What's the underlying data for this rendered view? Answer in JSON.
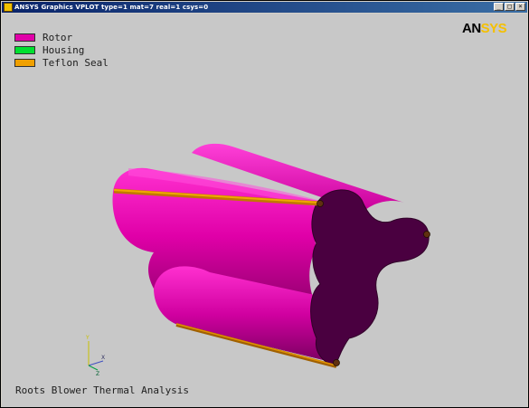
{
  "window": {
    "title": "ANSYS Graphics  VPLOT  type=1 mat=7 real=1 csys=0",
    "minimize_glyph": "_",
    "restore_glyph": "□",
    "close_glyph": "×"
  },
  "legend": {
    "items": [
      {
        "label": "Rotor",
        "color": "#e000a8"
      },
      {
        "label": "Housing",
        "color": "#00e030"
      },
      {
        "label": "Teflon Seal",
        "color": "#f0a000"
      }
    ]
  },
  "logo": {
    "part1": "AN",
    "part2": "SYS"
  },
  "triad": {
    "y_label": "Y",
    "x_label": "X",
    "z_label": "Z"
  },
  "caption": "Roots Blower Thermal Analysis",
  "colors": {
    "background": "#c8c8c8",
    "rotor_side": "#c00090",
    "rotor_face": "#4a0040",
    "seal": "#e09000"
  }
}
